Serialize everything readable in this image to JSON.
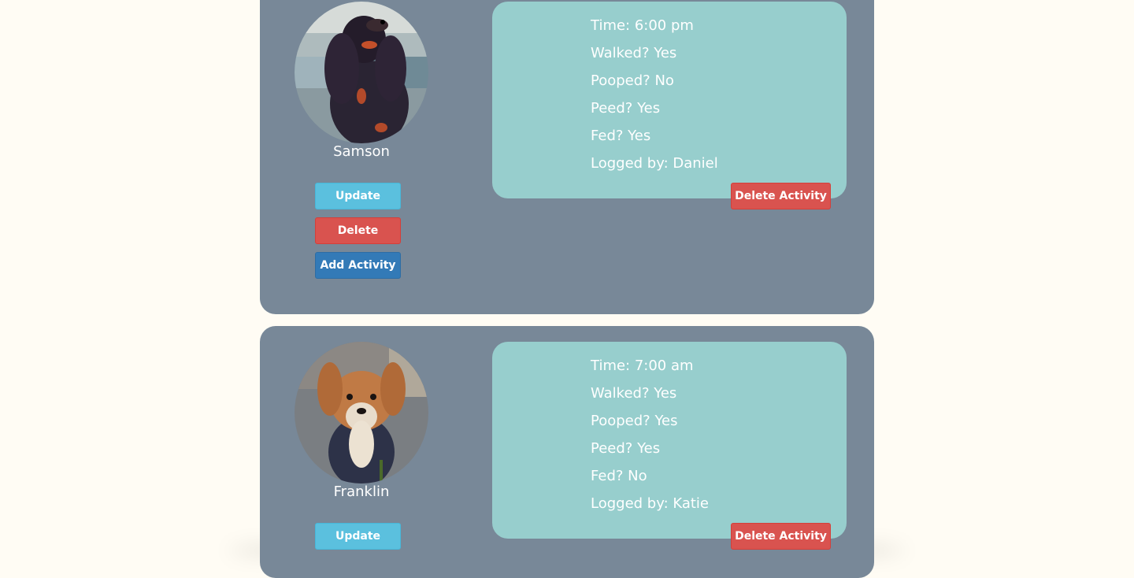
{
  "dogs": [
    {
      "name": "Samson",
      "photo_icon": "dog-photo-black-spaniel",
      "buttons": {
        "update": "Update",
        "delete": "Delete",
        "add_activity": "Add Activity"
      },
      "activity": {
        "time": "Time: 6:00 pm",
        "walked": "Walked? Yes",
        "pooped": "Pooped? No",
        "peed": "Peed? Yes",
        "fed": "Fed? Yes",
        "logged_by": "Logged by: Daniel",
        "delete_label": "Delete Activity"
      }
    },
    {
      "name": "Franklin",
      "photo_icon": "dog-photo-tan-terrier",
      "buttons": {
        "update": "Update"
      },
      "activity": {
        "time": "Time: 7:00 am",
        "walked": "Walked? Yes",
        "pooped": "Pooped? Yes",
        "peed": "Peed? Yes",
        "fed": "Fed? No",
        "logged_by": "Logged by: Katie",
        "delete_label": "Delete Activity"
      }
    }
  ],
  "colors": {
    "page_background": "#fffcf4",
    "card_background": "#788898",
    "activity_background": "#97cecd",
    "update_button": "#5bc0de",
    "delete_button": "#d9534f",
    "add_activity_button": "#337ab7"
  }
}
